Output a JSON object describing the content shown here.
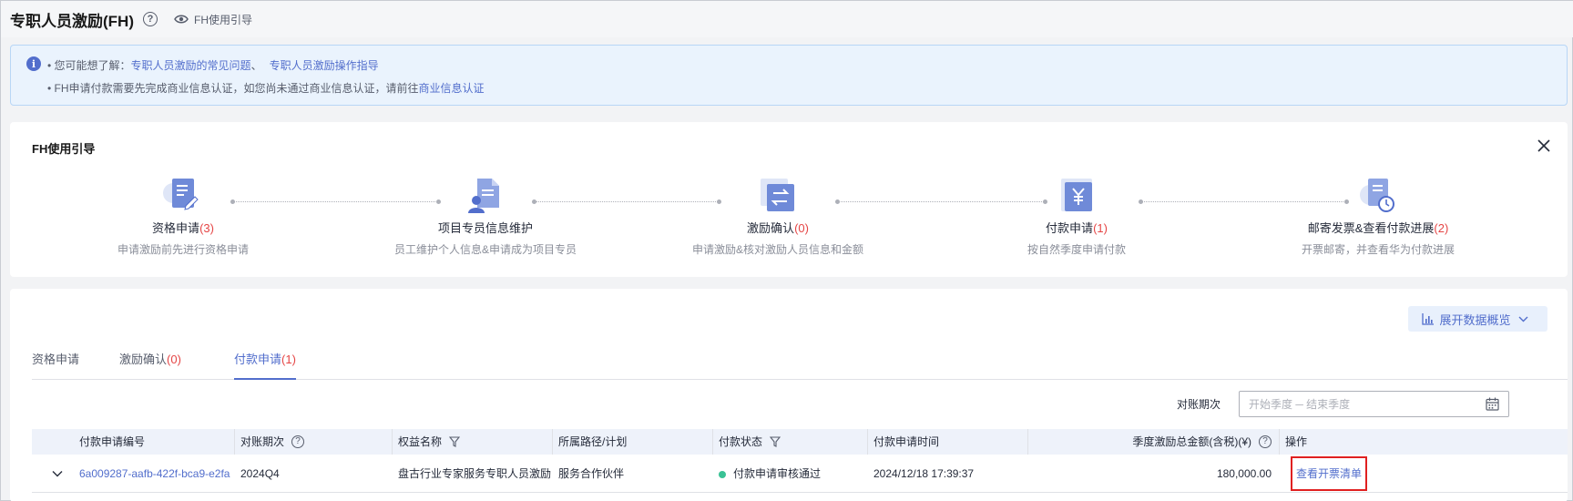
{
  "header": {
    "title": "专职人员激励(FH)",
    "help_glyph": "?",
    "guide_link": "FH使用引导"
  },
  "notice": {
    "line1_prefix": "• 您可能想了解：",
    "link_faq": "专职人员激励的常见问题",
    "separator": "、",
    "link_guide": "专职人员激励操作指导",
    "line2_prefix": "• FH申请付款需要先完成商业信息认证，如您尚未通过商业信息认证，请前往",
    "link_cert": "商业信息认证"
  },
  "guide": {
    "title": "FH使用引导",
    "steps": [
      {
        "name": "资格申请",
        "count": "(3)",
        "desc": "申请激励前先进行资格申请",
        "icon": "edit-document-icon"
      },
      {
        "name": "项目专员信息维护",
        "count": "",
        "desc": "员工维护个人信息&申请成为项目专员",
        "icon": "user-document-icon"
      },
      {
        "name": "激励确认",
        "count": "(0)",
        "desc": "申请激励&核对激励人员信息和金额",
        "icon": "transfer-icon"
      },
      {
        "name": "付款申请",
        "count": "(1)",
        "desc": "按自然季度申请付款",
        "icon": "yuan-icon"
      },
      {
        "name": "邮寄发票&查看付款进展",
        "count": "(2)",
        "desc": "开票邮寄，并查看华为付款进展",
        "icon": "clock-document-icon"
      }
    ]
  },
  "data_section": {
    "expand_label": "展开数据概览",
    "tabs": [
      {
        "label": "资格申请",
        "count": ""
      },
      {
        "label": "激励确认",
        "count": "(0)"
      },
      {
        "label": "付款申请",
        "count": "(1)"
      }
    ],
    "filter_label": "对账期次",
    "date_placeholder": "开始季度 ─ 结束季度",
    "columns": [
      "付款申请编号",
      "对账期次",
      "权益名称",
      "所属路径/计划",
      "付款状态",
      "付款申请时间",
      "季度激励总金额(含税)(¥)",
      "操作"
    ],
    "rows": [
      {
        "id": "6a009287-aafb-422f-bca9-e2fa...",
        "period": "2024Q4",
        "benefit": "盘古行业专家服务专职人员激励",
        "path": "服务合作伙伴",
        "status": "付款申请审核通过",
        "time": "2024/12/18 17:39:37",
        "amount": "180,000.00",
        "action": "查看开票清单"
      }
    ]
  },
  "colors": {
    "accent": "#526ecc",
    "count_red": "#e54545",
    "status_green": "#3ac295",
    "highlight_border": "#e02020"
  }
}
